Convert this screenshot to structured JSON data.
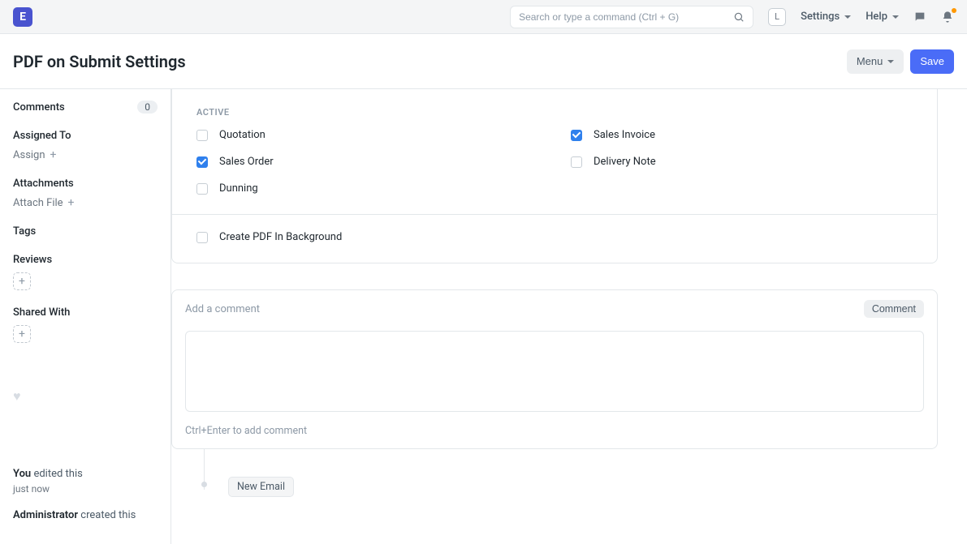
{
  "navbar": {
    "logo_letter": "E",
    "search_placeholder": "Search or type a command (Ctrl + G)",
    "avatar_letter": "L",
    "settings_label": "Settings",
    "help_label": "Help"
  },
  "page": {
    "title": "PDF on Submit Settings",
    "menu_btn": "Menu",
    "save_btn": "Save"
  },
  "sidebar": {
    "comments_label": "Comments",
    "comments_count": "0",
    "assigned_to_title": "Assigned To",
    "assign_action": "Assign",
    "attachments_title": "Attachments",
    "attach_action": "Attach File",
    "tags_title": "Tags",
    "reviews_title": "Reviews",
    "shared_title": "Shared With",
    "activity": [
      {
        "who": "You",
        "text": "edited this",
        "time": "just now"
      },
      {
        "who": "Administrator",
        "text": "created this",
        "time": ""
      }
    ]
  },
  "form": {
    "section_title": "ACTIVE",
    "checks": {
      "quotation": {
        "label": "Quotation",
        "checked": false
      },
      "sales_invoice": {
        "label": "Sales Invoice",
        "checked": true
      },
      "sales_order": {
        "label": "Sales Order",
        "checked": true
      },
      "delivery_note": {
        "label": "Delivery Note",
        "checked": false
      },
      "dunning": {
        "label": "Dunning",
        "checked": false
      },
      "create_bg": {
        "label": "Create PDF In Background",
        "checked": false
      }
    }
  },
  "comment_box": {
    "placeholder": "Add a comment",
    "button": "Comment",
    "hint": "Ctrl+Enter to add comment"
  },
  "timeline": {
    "new_email": "New Email"
  }
}
